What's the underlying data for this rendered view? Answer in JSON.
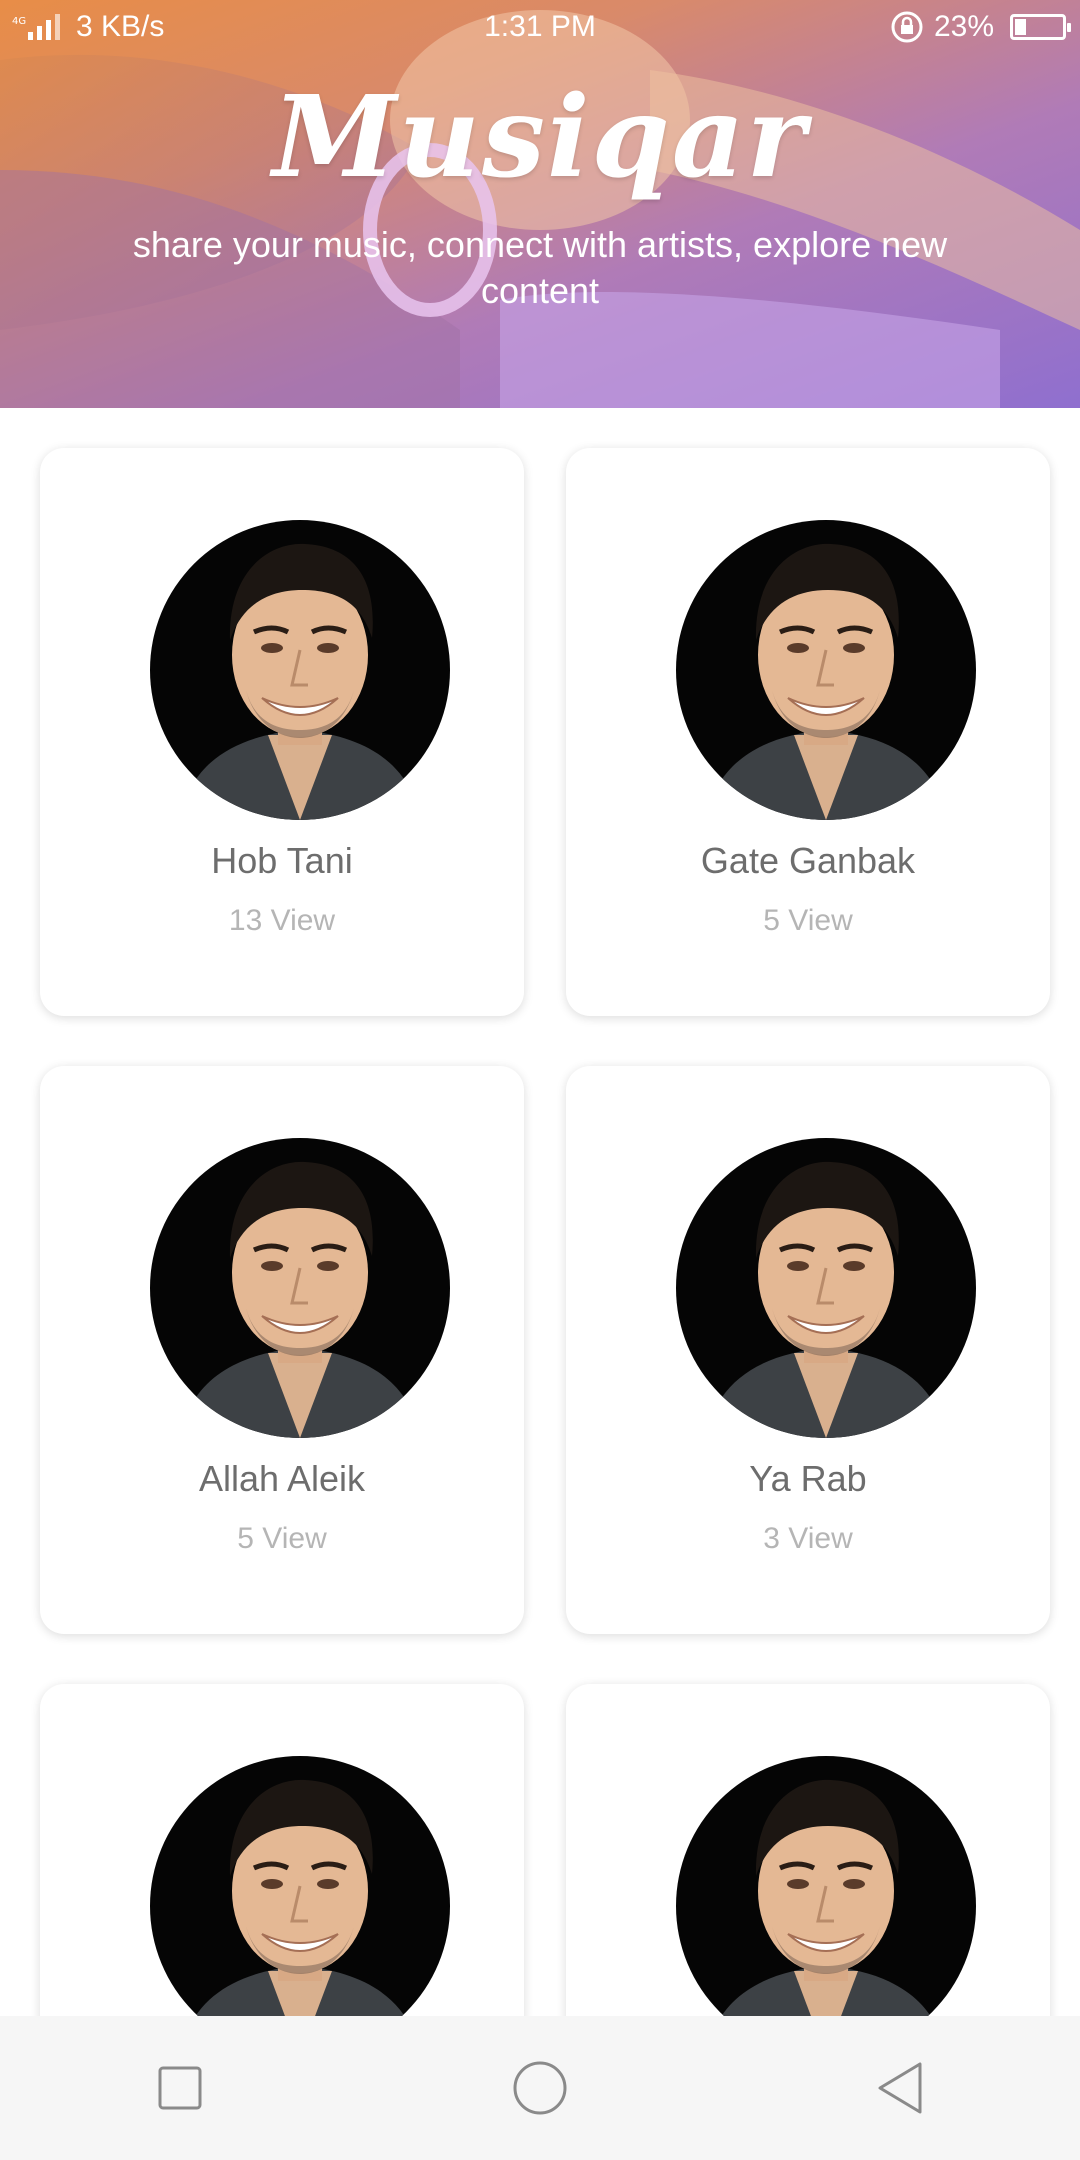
{
  "status_bar": {
    "network": "3 KB/s",
    "time": "1:31 PM",
    "battery_percent": "23%",
    "battery_level": 0.23
  },
  "header": {
    "title": "Musiqar",
    "tagline": "share your music, connect with artists, explore new content"
  },
  "songs": [
    {
      "title": "Hob Tani",
      "views": "13 View"
    },
    {
      "title": "Gate Ganbak",
      "views": "5 View"
    },
    {
      "title": "Allah Aleik",
      "views": "5 View"
    },
    {
      "title": "Ya Rab",
      "views": "3 View"
    },
    {
      "title": "",
      "views": ""
    },
    {
      "title": "",
      "views": ""
    }
  ],
  "nav": {
    "icons": [
      "recent-apps-icon",
      "home-icon",
      "back-icon"
    ]
  },
  "colors": {
    "header_gradient_start": "#e88d47",
    "header_gradient_end": "#8f6fcf",
    "title_text": "#6d6d6d",
    "views_text": "#b5b5b5",
    "navbar_bg": "#f6f6f6"
  }
}
